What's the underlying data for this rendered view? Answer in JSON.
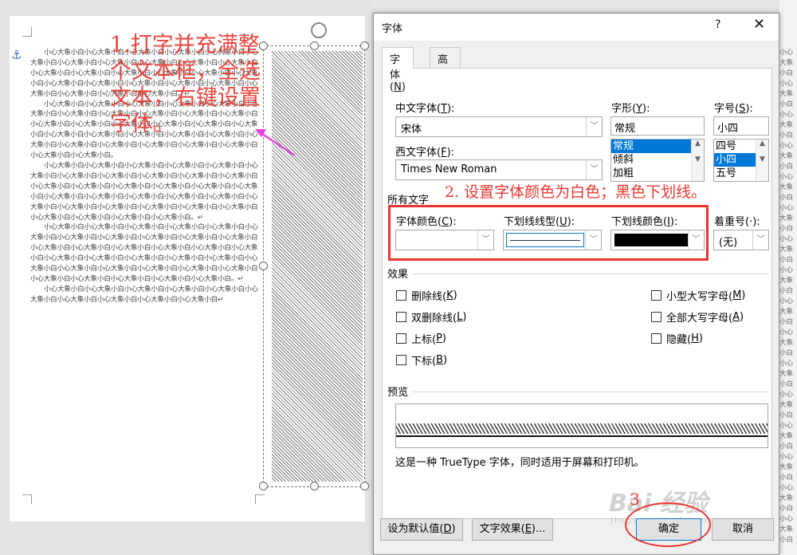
{
  "doc": {
    "paragraphs": [
      "小心大象小白小心大象小白小心大象小白小心大象小白小心大象小白小心大象小白小心大象小白小心大象小白小心大象小白小心大象小白小心大象小白小心大象小白小心大象小白小心大象小白小心大象小白小心大象小白小心大象小白小心大象小白小心大象小白小心大象小白小心大象小白小心大象小白小心大象小白小心大象小白小心大象小白小心大象小白。↵",
      "小心大象小白小心大象小白小心大象小白小心大象小白小心大象小白小心大象小白小心大象小白小心大象小白小心大象小白小心大象小白小心大象小白小心大象小白小心大象小白小心大象小白小心大象小白小心大象小白小心大象小白小心大象小白小心大象小白小心大象小白小心大象小白小心大象小白小心大象小白小心大象小白小心大象小白小心大象小白小心大象小白小心大象小白小心大象小白小心大象小白。",
      "小心大象小白小心大象小白小心大象小白小心大象小白小心大象小白小心大象小白小心大象小白小心大象小白小心大象小白小心大象小白小心大象小白小心大象小白小心大象小白小心大象小白小心大象小白小心大象小白小心大象小白小心大象小白小心大象小白小心大象小白小心大象小白小心大象小白小心大象小白小心大象小白小心大象小白小心大象小白小心大象小白小心大象小白小心大象小白小心大象小白小心大象小白小心大象小白。↵",
      "小心大象小白小心大象小白小心大象小白小心大象小白小心大象小白小心大象小白小心大象小白小心大象小白小心大象小白小心大象小白小心大象小白小心大象小白小心大象小白小心大象小白小心大象小白小心大象小白小心大象小白小心大象小白小心大象小白小心大象小白小心大象小白小心大象小白小心大象小白小心大象小白小心大象小白小心大象小白小心大象小白小心大象小白小心大象小白小心大象小白小心大象小白小心大象小白小心大象小白。↵",
      "小心大象小白小心大象小白小心大象小白小心大象小白小心大象小白小心大象小白小心大象小白小心大象小白小心大象小白小心大象小白↵"
    ],
    "right_sliver_text": "小心大象小白小心大象小白小心大象小白小心大象小白小心大象小白小心大象小白小心大象小白小心大象小白小心大象小白小心大象小白小心大象小白小心大象小白小心大象小白小心大象小白小心大象小白小心大象小白",
    "annotation_1": "1.打字并充满整个文本框，全选文本，右键设置字体。"
  },
  "dialog": {
    "title": "字体",
    "help": "?",
    "close": "✕",
    "tabs": [
      {
        "label": "字体(",
        "key": "N",
        "suffix": ")"
      },
      {
        "label": "高级(",
        "key": "V",
        "suffix": ")"
      }
    ],
    "chinese_font": {
      "label": "中文字体(",
      "key": "T",
      "suffix": "):",
      "value": "宋体"
    },
    "western_font": {
      "label": "西文字体(",
      "key": "F",
      "suffix": "):",
      "value": "Times New Roman"
    },
    "style": {
      "label": "字形(",
      "key": "Y",
      "suffix": "):",
      "value": "常规",
      "options": [
        "常规",
        "倾斜",
        "加粗"
      ]
    },
    "size": {
      "label": "字号(",
      "key": "S",
      "suffix": "):",
      "value": "小四",
      "options": [
        "四号",
        "小四",
        "五号"
      ]
    },
    "all_text_label": "所有文字",
    "font_color": {
      "label": "字体颜色(",
      "key": "C",
      "suffix": "):",
      "value": "#ffffff"
    },
    "underline_style": {
      "label": "下划线线型(",
      "key": "U",
      "suffix": "):"
    },
    "underline_color": {
      "label": "下划线颜色(",
      "key": "I",
      "suffix": "):",
      "value": "#000000"
    },
    "emphasis": {
      "label": "着重号(·):",
      "value": "(无)"
    },
    "annotation_2": "2. 设置字体颜色为白色；黑色下划线。",
    "effects_label": "效果",
    "effects_left": [
      {
        "label": "删除线(",
        "key": "K",
        "suffix": ")"
      },
      {
        "label": "双删除线(",
        "key": "L",
        "suffix": ")"
      },
      {
        "label": "上标(",
        "key": "P",
        "suffix": ")"
      },
      {
        "label": "下标(",
        "key": "B",
        "suffix": ")"
      }
    ],
    "effects_right": [
      {
        "label": "小型大写字母(",
        "key": "M",
        "suffix": ")"
      },
      {
        "label": "全部大写字母(",
        "key": "A",
        "suffix": ")"
      },
      {
        "label": "隐藏(",
        "key": "H",
        "suffix": ")"
      }
    ],
    "preview_label": "预览",
    "preview_note": "这是一种 TrueType 字体，同时适用于屏幕和打印机。",
    "buttons": {
      "set_default": {
        "label": "设为默认值(",
        "key": "D",
        "suffix": ")"
      },
      "text_effects": {
        "label": "文字效果(",
        "key": "E",
        "suffix": ")..."
      },
      "ok": "确定",
      "cancel": "取消"
    },
    "annotation_3": "3",
    "watermark": "Bai 经验",
    "watermark_sub": "jingyan.baidu.com"
  },
  "colors": {
    "accent": "#0078d7",
    "annotation": "#e8372e"
  }
}
